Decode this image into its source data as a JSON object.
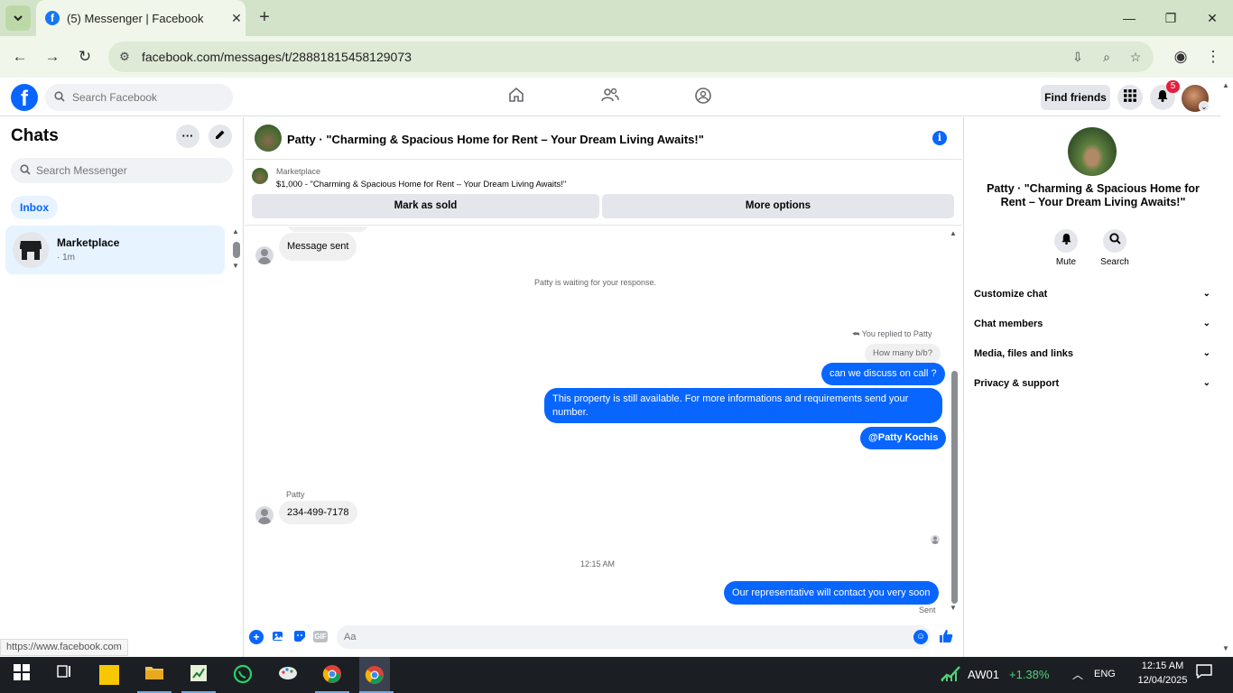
{
  "browser": {
    "tab_title": "(5) Messenger | Facebook",
    "url": "facebook.com/messages/t/28881815458129073",
    "status_url": "https://www.facebook.com"
  },
  "fb_header": {
    "search_placeholder": "Search Facebook",
    "find_friends": "Find friends",
    "notification_count": "5"
  },
  "left_panel": {
    "title": "Chats",
    "search_placeholder": "Search Messenger",
    "filter": "Inbox",
    "chats": [
      {
        "name": "Marketplace",
        "time": "· 1m"
      }
    ]
  },
  "conversation": {
    "title": "Patty · \"Charming & Spacious Home for Rent – Your Dream Living Awaits!\"",
    "listing": {
      "label": "Marketplace",
      "title": "$1,000 - \"Charming & Spacious Home for Rent – Your Dream Living Awaits!\"",
      "mark_sold": "Mark as sold",
      "more_options": "More options"
    },
    "messages": {
      "message_sent": "Message sent",
      "waiting": "Patty is waiting for your response.",
      "replied_to": "You replied to Patty",
      "quoted": "How many b/b?",
      "out1": "can we discuss on call ?",
      "out2": "This property is still available. For more informations and requirements send your number.",
      "out3": "@Patty Kochis",
      "sender_name": "Patty",
      "in_phone": "234-499-7178",
      "timestamp": "12:15 AM",
      "out4": "Our representative will contact you very soon",
      "status": "Sent"
    },
    "composer_placeholder": "Aa",
    "gif_label": "GIF"
  },
  "right_panel": {
    "title": "Patty · \"Charming & Spacious Home for Rent – Your Dream Living Awaits!\"",
    "mute": "Mute",
    "search": "Search",
    "sections": [
      "Customize chat",
      "Chat members",
      "Media, files and links",
      "Privacy & support"
    ]
  },
  "taskbar": {
    "stock_symbol": "AW01",
    "stock_change": "+1.38%",
    "language": "ENG",
    "time": "12:15 AM",
    "date": "12/04/2025"
  },
  "colors": {
    "brand_blue": "#0866ff",
    "tabstrip": "#d3e3c9",
    "toolbar": "#f0f7ea",
    "badge_red": "#e41e3f"
  }
}
